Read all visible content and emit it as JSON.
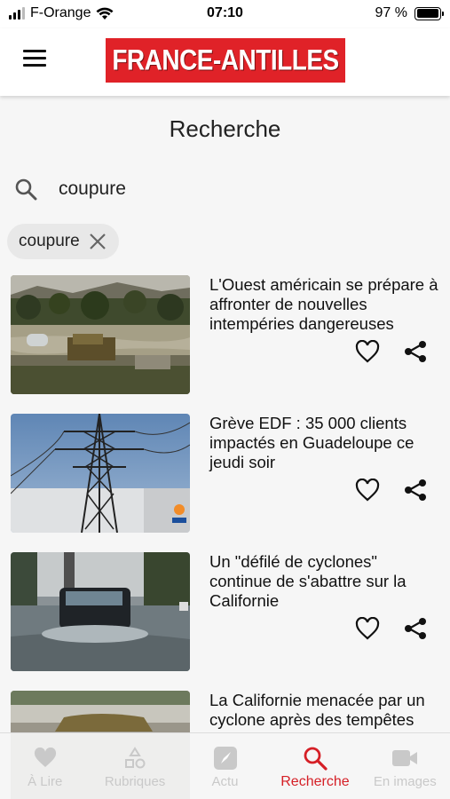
{
  "status_bar": {
    "carrier": "F-Orange",
    "time": "07:10",
    "battery": "97 %",
    "battery_level": 0.97
  },
  "header": {
    "logo_text": "FRANCE-ANTILLES",
    "brand_color": "#e02228"
  },
  "page": {
    "title": "Recherche"
  },
  "search": {
    "value": "coupure",
    "chip_label": "coupure"
  },
  "articles": [
    {
      "title": "L'Ouest américain se prépare à affronter de nouvelles intempéries dangereuses"
    },
    {
      "title": "Grève EDF : 35 000 clients impactés en Guadeloupe ce jeudi soir"
    },
    {
      "title": "Un \"défilé de cyclones\" continue de s'abattre sur la Californie"
    },
    {
      "title": "La Californie menacée par un cyclone après des tempêtes"
    }
  ],
  "tabbar": {
    "items": [
      {
        "label": "À Lire",
        "icon": "heart-icon"
      },
      {
        "label": "Rubriques",
        "icon": "shapes-icon"
      },
      {
        "label": "Actu",
        "icon": "compass-icon"
      },
      {
        "label": "Recherche",
        "icon": "search-icon",
        "active": true
      },
      {
        "label": "En images",
        "icon": "video-camera-icon"
      }
    ],
    "active_color": "#d51f26"
  }
}
